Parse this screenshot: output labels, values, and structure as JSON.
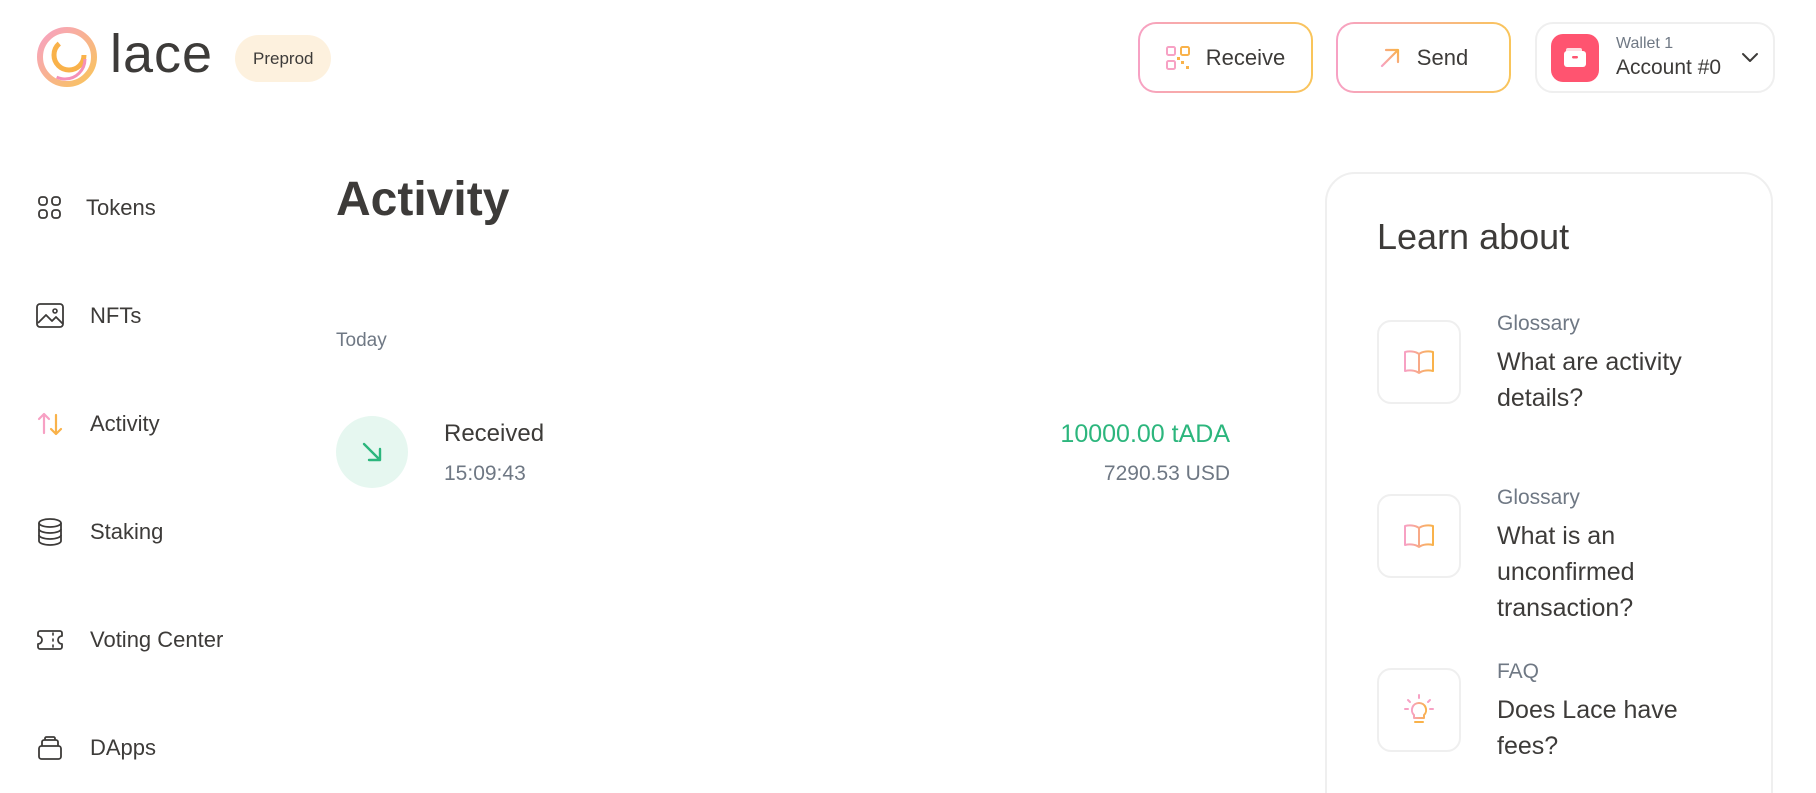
{
  "app": {
    "name": "lace",
    "network": "Preprod"
  },
  "header": {
    "receive_label": "Receive",
    "send_label": "Send",
    "wallet": {
      "name": "Wallet 1",
      "account": "Account #0"
    }
  },
  "sidebar": {
    "items": [
      {
        "label": "Tokens",
        "icon": "grid-icon"
      },
      {
        "label": "NFTs",
        "icon": "image-icon"
      },
      {
        "label": "Activity",
        "icon": "arrows-up-down-icon",
        "active": true
      },
      {
        "label": "Staking",
        "icon": "database-icon"
      },
      {
        "label": "Voting Center",
        "icon": "ticket-icon"
      },
      {
        "label": "DApps",
        "icon": "stack-icon"
      }
    ]
  },
  "main": {
    "title": "Activity",
    "groups": [
      {
        "label": "Today",
        "transactions": [
          {
            "type": "Received",
            "time": "15:09:43",
            "amount": "10000.00 tADA",
            "fiat": "7290.53 USD"
          }
        ]
      }
    ]
  },
  "learn": {
    "title": "Learn about",
    "items": [
      {
        "category": "Glossary",
        "question": "What are activity details?",
        "icon": "book-icon"
      },
      {
        "category": "Glossary",
        "question": "What is an unconfirmed transaction?",
        "icon": "book-icon"
      },
      {
        "category": "FAQ",
        "question": "Does Lace have fees?",
        "icon": "lightbulb-icon"
      }
    ]
  },
  "colors": {
    "brand_pink": "#f7a1c4",
    "brand_orange": "#f9c55a",
    "positive_green": "#2cb67d",
    "wallet_red": "#ff5470",
    "text": "#3d3b39",
    "muted": "#6f7884"
  }
}
